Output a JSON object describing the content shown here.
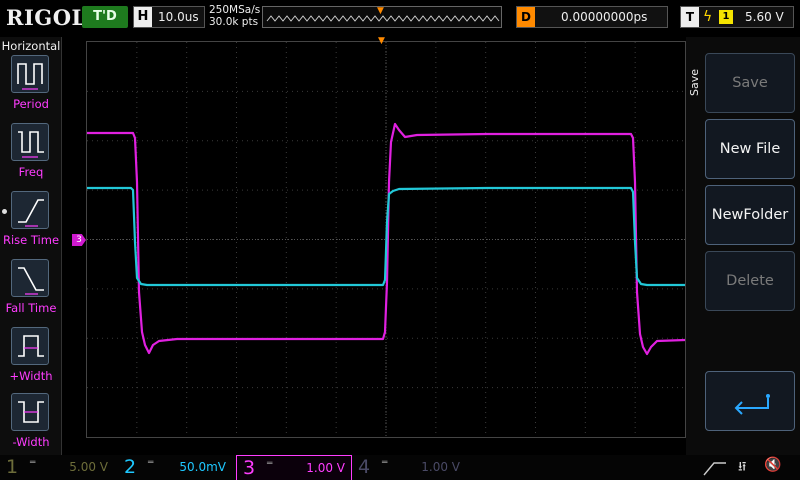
{
  "header": {
    "brand": "RIGOL",
    "run_state": "T'D",
    "timebase_tag": "H",
    "timebase": "10.0us",
    "sample_rate": "250MSa/s",
    "memory_depth": "30.0k pts",
    "delay_tag": "D",
    "delay": "0.00000000ps",
    "trigger_tag": "T",
    "trigger_source": "1",
    "trigger_level": "5.60 V"
  },
  "left_menu": {
    "title": "Horizontal",
    "items": [
      {
        "label": "Period",
        "icon": "period-icon"
      },
      {
        "label": "Freq",
        "icon": "freq-icon"
      },
      {
        "label": "Rise Time",
        "icon": "rise-time-icon"
      },
      {
        "label": "Fall Time",
        "icon": "fall-time-icon"
      },
      {
        "label": "+Width",
        "icon": "positive-width-icon"
      },
      {
        "label": "-Width",
        "icon": "negative-width-icon"
      }
    ]
  },
  "right_menu": {
    "title": "Save",
    "buttons": [
      {
        "label": "Save",
        "enabled": false
      },
      {
        "label": "New File",
        "enabled": true
      },
      {
        "label": "NewFolder",
        "enabled": true
      },
      {
        "label": "Delete",
        "enabled": false
      }
    ],
    "back_icon": "return-arrow-icon"
  },
  "markers": {
    "ch3_offset": "3",
    "trigger_level": "T"
  },
  "channels": [
    {
      "num": "1",
      "scale": "5.00 V",
      "color": "#6d6d3a",
      "active": false
    },
    {
      "num": "2",
      "scale": "50.0mV",
      "color": "#1ec8ff",
      "active": true
    },
    {
      "num": "3",
      "scale": "1.00 V",
      "color": "#ff3dff",
      "active": true,
      "selected": true
    },
    {
      "num": "4",
      "scale": "1.00 V",
      "color": "#4a4a66",
      "active": false
    }
  ],
  "status_icons": [
    "usb-icon",
    "mute-icon"
  ],
  "waveforms": {
    "ch3_color": "#e020e0",
    "ch2_color": "#22c8d8"
  }
}
